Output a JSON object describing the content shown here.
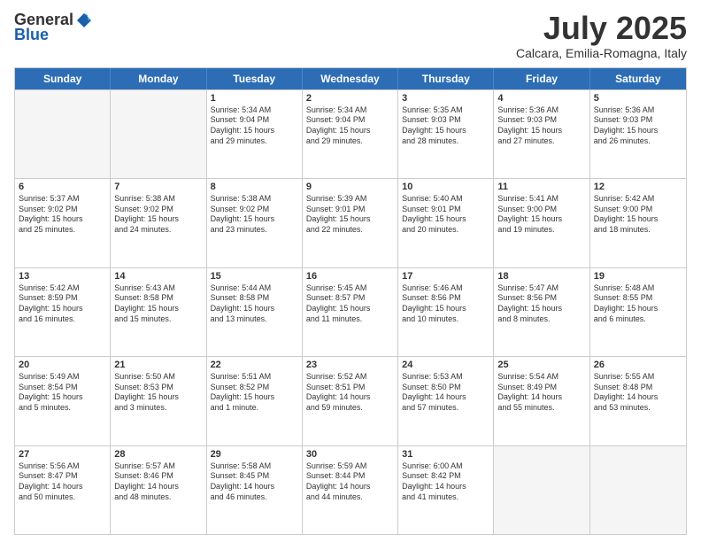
{
  "logo": {
    "general": "General",
    "blue": "Blue"
  },
  "title": "July 2025",
  "subtitle": "Calcara, Emilia-Romagna, Italy",
  "header_days": [
    "Sunday",
    "Monday",
    "Tuesday",
    "Wednesday",
    "Thursday",
    "Friday",
    "Saturday"
  ],
  "weeks": [
    [
      {
        "day": "",
        "info": "",
        "empty": true
      },
      {
        "day": "",
        "info": "",
        "empty": true
      },
      {
        "day": "1",
        "info": "Sunrise: 5:34 AM\nSunset: 9:04 PM\nDaylight: 15 hours\nand 29 minutes.",
        "empty": false
      },
      {
        "day": "2",
        "info": "Sunrise: 5:34 AM\nSunset: 9:04 PM\nDaylight: 15 hours\nand 29 minutes.",
        "empty": false
      },
      {
        "day": "3",
        "info": "Sunrise: 5:35 AM\nSunset: 9:03 PM\nDaylight: 15 hours\nand 28 minutes.",
        "empty": false
      },
      {
        "day": "4",
        "info": "Sunrise: 5:36 AM\nSunset: 9:03 PM\nDaylight: 15 hours\nand 27 minutes.",
        "empty": false
      },
      {
        "day": "5",
        "info": "Sunrise: 5:36 AM\nSunset: 9:03 PM\nDaylight: 15 hours\nand 26 minutes.",
        "empty": false
      }
    ],
    [
      {
        "day": "6",
        "info": "Sunrise: 5:37 AM\nSunset: 9:02 PM\nDaylight: 15 hours\nand 25 minutes.",
        "empty": false
      },
      {
        "day": "7",
        "info": "Sunrise: 5:38 AM\nSunset: 9:02 PM\nDaylight: 15 hours\nand 24 minutes.",
        "empty": false
      },
      {
        "day": "8",
        "info": "Sunrise: 5:38 AM\nSunset: 9:02 PM\nDaylight: 15 hours\nand 23 minutes.",
        "empty": false
      },
      {
        "day": "9",
        "info": "Sunrise: 5:39 AM\nSunset: 9:01 PM\nDaylight: 15 hours\nand 22 minutes.",
        "empty": false
      },
      {
        "day": "10",
        "info": "Sunrise: 5:40 AM\nSunset: 9:01 PM\nDaylight: 15 hours\nand 20 minutes.",
        "empty": false
      },
      {
        "day": "11",
        "info": "Sunrise: 5:41 AM\nSunset: 9:00 PM\nDaylight: 15 hours\nand 19 minutes.",
        "empty": false
      },
      {
        "day": "12",
        "info": "Sunrise: 5:42 AM\nSunset: 9:00 PM\nDaylight: 15 hours\nand 18 minutes.",
        "empty": false
      }
    ],
    [
      {
        "day": "13",
        "info": "Sunrise: 5:42 AM\nSunset: 8:59 PM\nDaylight: 15 hours\nand 16 minutes.",
        "empty": false
      },
      {
        "day": "14",
        "info": "Sunrise: 5:43 AM\nSunset: 8:58 PM\nDaylight: 15 hours\nand 15 minutes.",
        "empty": false
      },
      {
        "day": "15",
        "info": "Sunrise: 5:44 AM\nSunset: 8:58 PM\nDaylight: 15 hours\nand 13 minutes.",
        "empty": false
      },
      {
        "day": "16",
        "info": "Sunrise: 5:45 AM\nSunset: 8:57 PM\nDaylight: 15 hours\nand 11 minutes.",
        "empty": false
      },
      {
        "day": "17",
        "info": "Sunrise: 5:46 AM\nSunset: 8:56 PM\nDaylight: 15 hours\nand 10 minutes.",
        "empty": false
      },
      {
        "day": "18",
        "info": "Sunrise: 5:47 AM\nSunset: 8:56 PM\nDaylight: 15 hours\nand 8 minutes.",
        "empty": false
      },
      {
        "day": "19",
        "info": "Sunrise: 5:48 AM\nSunset: 8:55 PM\nDaylight: 15 hours\nand 6 minutes.",
        "empty": false
      }
    ],
    [
      {
        "day": "20",
        "info": "Sunrise: 5:49 AM\nSunset: 8:54 PM\nDaylight: 15 hours\nand 5 minutes.",
        "empty": false
      },
      {
        "day": "21",
        "info": "Sunrise: 5:50 AM\nSunset: 8:53 PM\nDaylight: 15 hours\nand 3 minutes.",
        "empty": false
      },
      {
        "day": "22",
        "info": "Sunrise: 5:51 AM\nSunset: 8:52 PM\nDaylight: 15 hours\nand 1 minute.",
        "empty": false
      },
      {
        "day": "23",
        "info": "Sunrise: 5:52 AM\nSunset: 8:51 PM\nDaylight: 14 hours\nand 59 minutes.",
        "empty": false
      },
      {
        "day": "24",
        "info": "Sunrise: 5:53 AM\nSunset: 8:50 PM\nDaylight: 14 hours\nand 57 minutes.",
        "empty": false
      },
      {
        "day": "25",
        "info": "Sunrise: 5:54 AM\nSunset: 8:49 PM\nDaylight: 14 hours\nand 55 minutes.",
        "empty": false
      },
      {
        "day": "26",
        "info": "Sunrise: 5:55 AM\nSunset: 8:48 PM\nDaylight: 14 hours\nand 53 minutes.",
        "empty": false
      }
    ],
    [
      {
        "day": "27",
        "info": "Sunrise: 5:56 AM\nSunset: 8:47 PM\nDaylight: 14 hours\nand 50 minutes.",
        "empty": false
      },
      {
        "day": "28",
        "info": "Sunrise: 5:57 AM\nSunset: 8:46 PM\nDaylight: 14 hours\nand 48 minutes.",
        "empty": false
      },
      {
        "day": "29",
        "info": "Sunrise: 5:58 AM\nSunset: 8:45 PM\nDaylight: 14 hours\nand 46 minutes.",
        "empty": false
      },
      {
        "day": "30",
        "info": "Sunrise: 5:59 AM\nSunset: 8:44 PM\nDaylight: 14 hours\nand 44 minutes.",
        "empty": false
      },
      {
        "day": "31",
        "info": "Sunrise: 6:00 AM\nSunset: 8:42 PM\nDaylight: 14 hours\nand 41 minutes.",
        "empty": false
      },
      {
        "day": "",
        "info": "",
        "empty": true
      },
      {
        "day": "",
        "info": "",
        "empty": true
      }
    ]
  ]
}
